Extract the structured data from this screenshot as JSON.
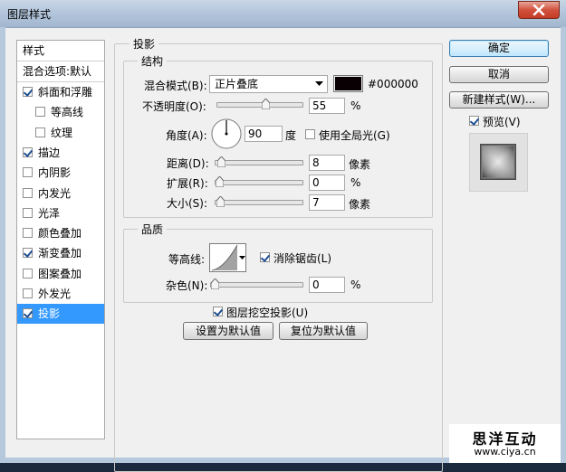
{
  "window": {
    "title": "图层样式"
  },
  "sidebar": {
    "header": "样式",
    "blend_options": "混合选项:默认",
    "items": [
      {
        "label": "斜面和浮雕",
        "checked": true,
        "indent": false
      },
      {
        "label": "等高线",
        "checked": false,
        "indent": true
      },
      {
        "label": "纹理",
        "checked": false,
        "indent": true
      },
      {
        "label": "描边",
        "checked": true,
        "indent": false
      },
      {
        "label": "内阴影",
        "checked": false,
        "indent": false
      },
      {
        "label": "内发光",
        "checked": false,
        "indent": false
      },
      {
        "label": "光泽",
        "checked": false,
        "indent": false
      },
      {
        "label": "颜色叠加",
        "checked": false,
        "indent": false
      },
      {
        "label": "渐变叠加",
        "checked": true,
        "indent": false
      },
      {
        "label": "图案叠加",
        "checked": false,
        "indent": false
      },
      {
        "label": "外发光",
        "checked": false,
        "indent": false
      },
      {
        "label": "投影",
        "checked": true,
        "indent": false,
        "selected": true
      }
    ]
  },
  "drop_shadow": {
    "title": "投影",
    "structure": {
      "title": "结构",
      "blend_mode_label": "混合模式(B):",
      "blend_mode_value": "正片叠底",
      "color_hex": "#000000",
      "opacity_label": "不透明度(O):",
      "opacity_value": "55",
      "opacity_unit": "%",
      "angle_label": "角度(A):",
      "angle_value": "90",
      "angle_unit": "度",
      "global_light_label": "使用全局光(G)",
      "global_light_checked": false,
      "distance_label": "距离(D):",
      "distance_value": "8",
      "distance_unit": "像素",
      "spread_label": "扩展(R):",
      "spread_value": "0",
      "spread_unit": "%",
      "size_label": "大小(S):",
      "size_value": "7",
      "size_unit": "像素"
    },
    "quality": {
      "title": "品质",
      "contour_label": "等高线:",
      "antialias_label": "消除锯齿(L)",
      "antialias_checked": true,
      "noise_label": "杂色(N):",
      "noise_value": "0",
      "noise_unit": "%"
    },
    "knockout_label": "图层挖空投影(U)",
    "knockout_checked": true,
    "make_default_label": "设置为默认值",
    "reset_default_label": "复位为默认值"
  },
  "actions": {
    "ok_label": "确定",
    "cancel_label": "取消",
    "new_style_label": "新建样式(W)...",
    "preview_label": "预览(V)",
    "preview_checked": true
  },
  "watermark": {
    "name": "思洋互动",
    "url": "www.ciya.cn"
  },
  "colors": {
    "shadow_color": "#080002",
    "selection": "#3399ff"
  }
}
